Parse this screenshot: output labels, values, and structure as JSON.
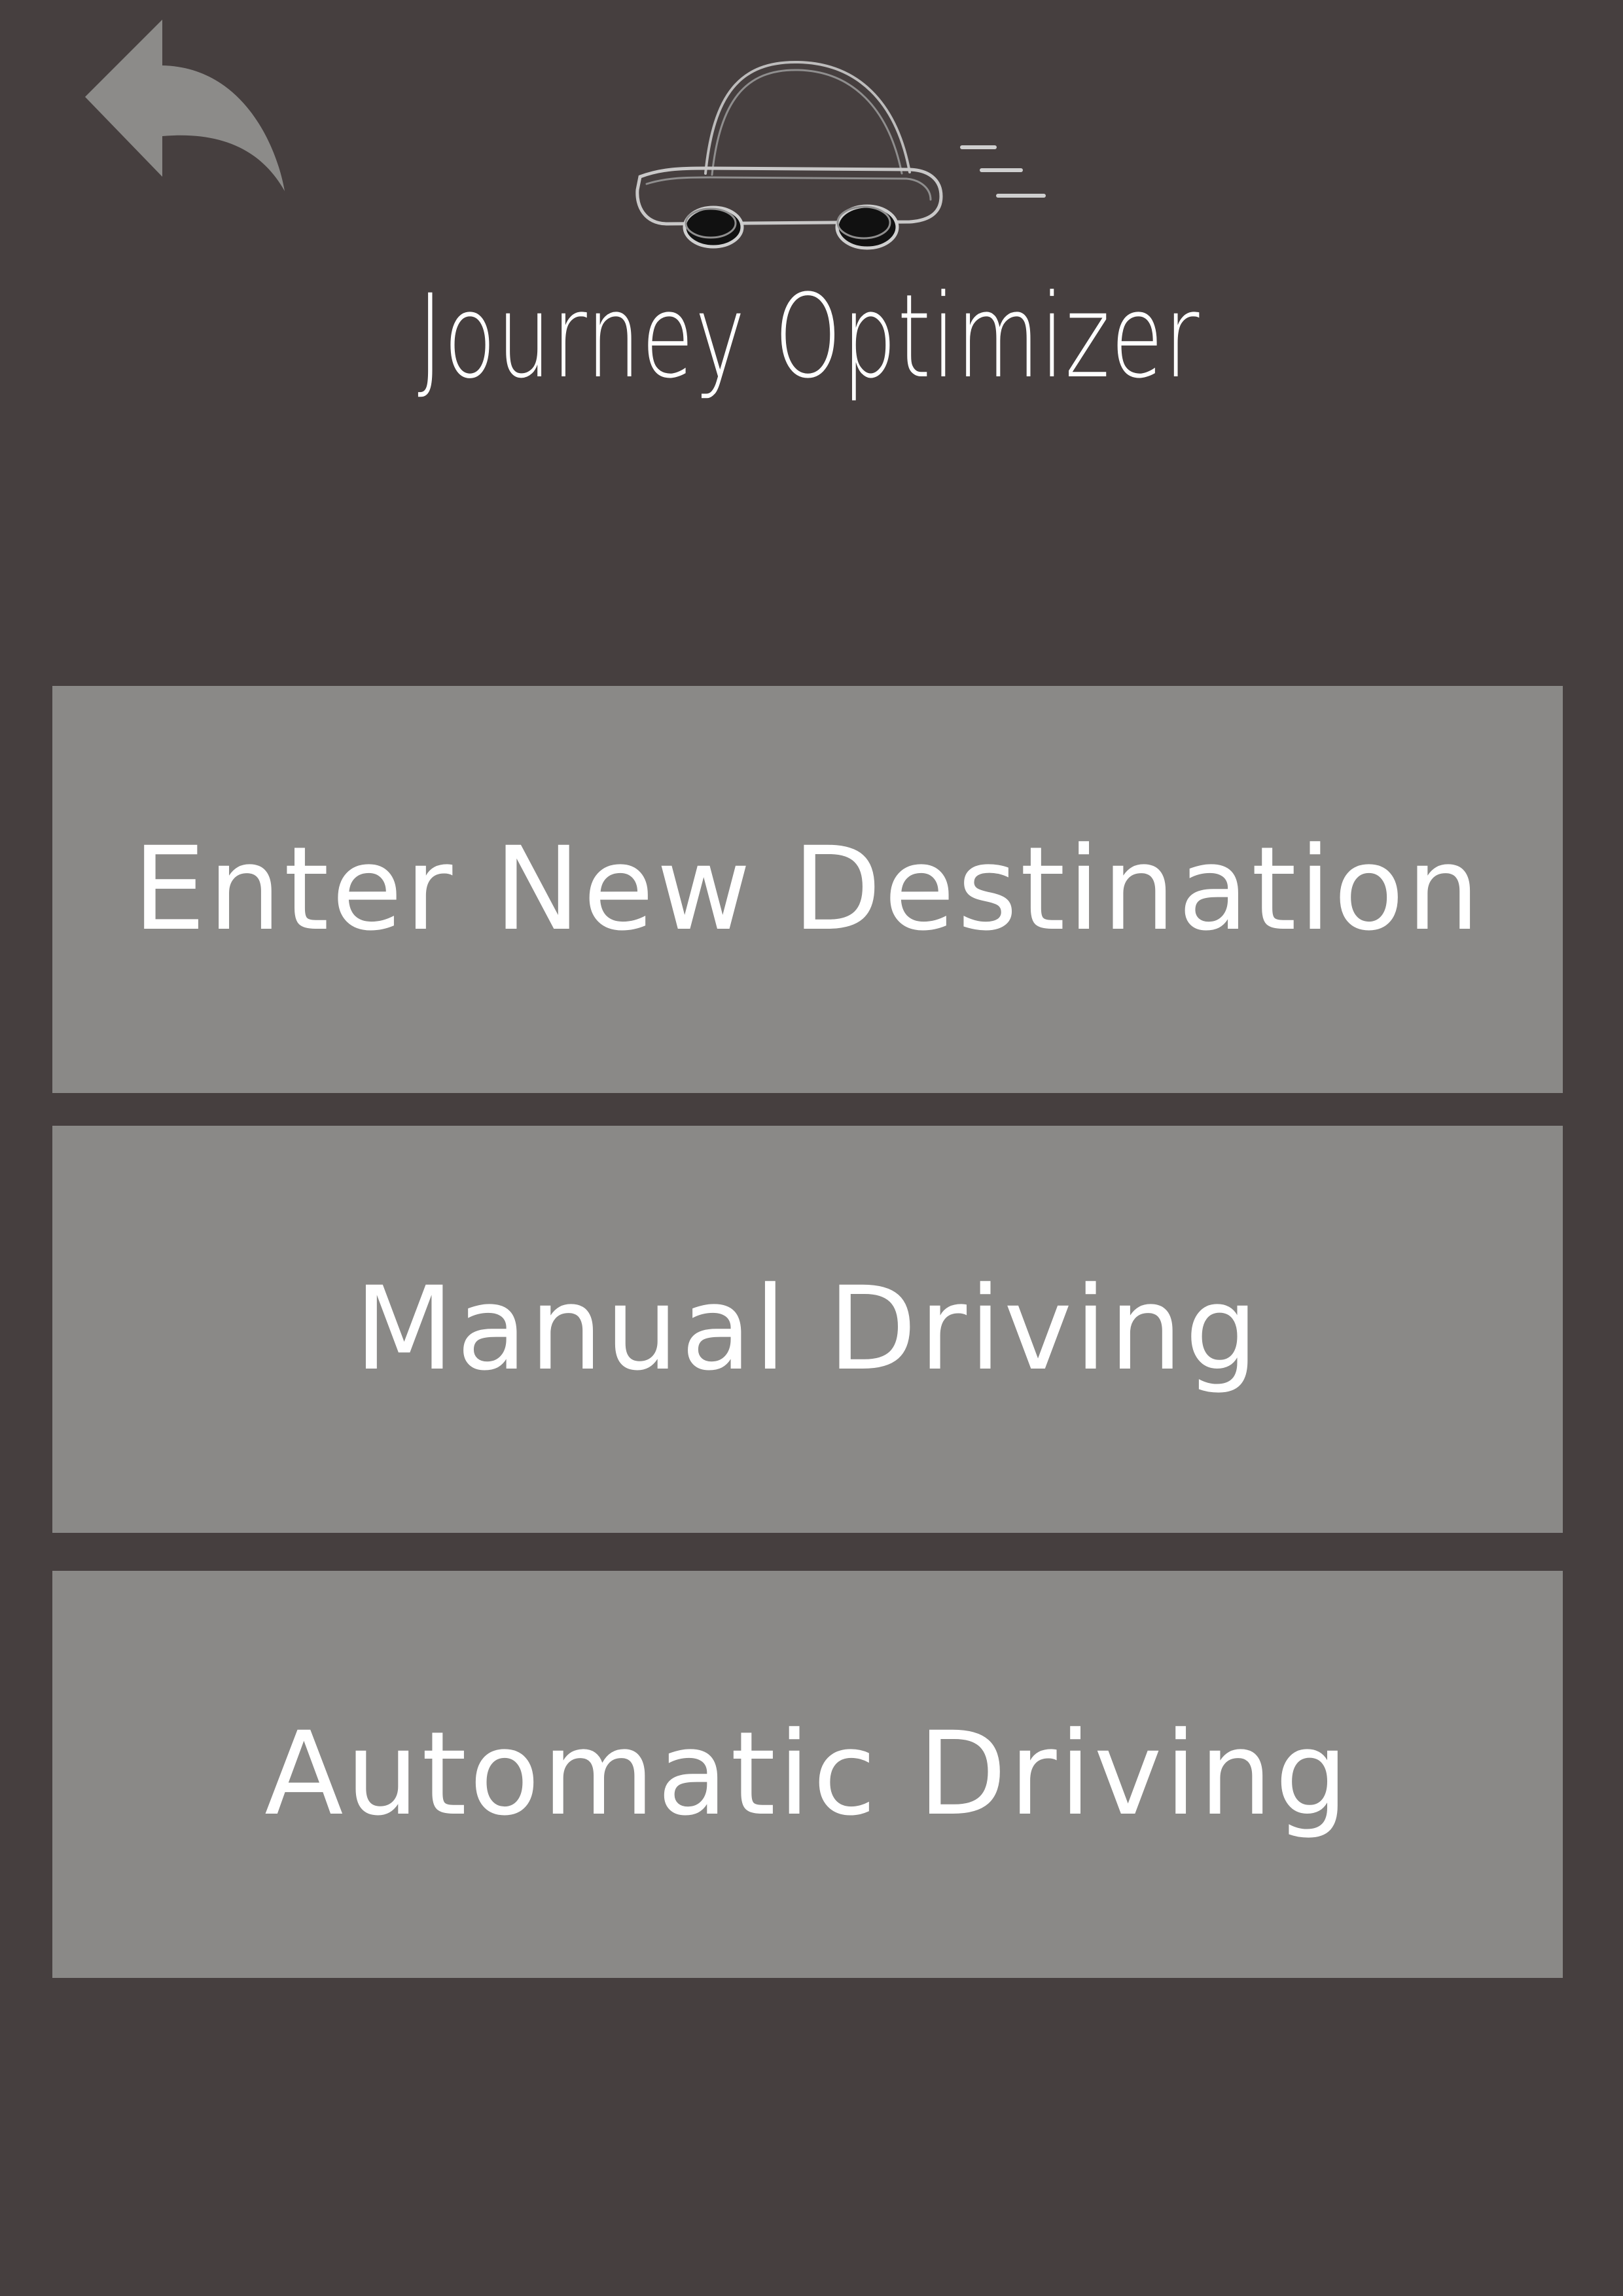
{
  "app": {
    "title": "Journey Optimizer"
  },
  "icons": {
    "back": "back-arrow-icon",
    "logo": "car-logo-icon"
  },
  "menu": {
    "items": [
      {
        "label": "Enter New Destination"
      },
      {
        "label": "Manual Driving"
      },
      {
        "label": "Automatic Driving"
      }
    ]
  },
  "colors": {
    "background": "#463f3f",
    "button": "#8a8987",
    "text": "#ffffff",
    "back_icon": "#8c8b89"
  }
}
